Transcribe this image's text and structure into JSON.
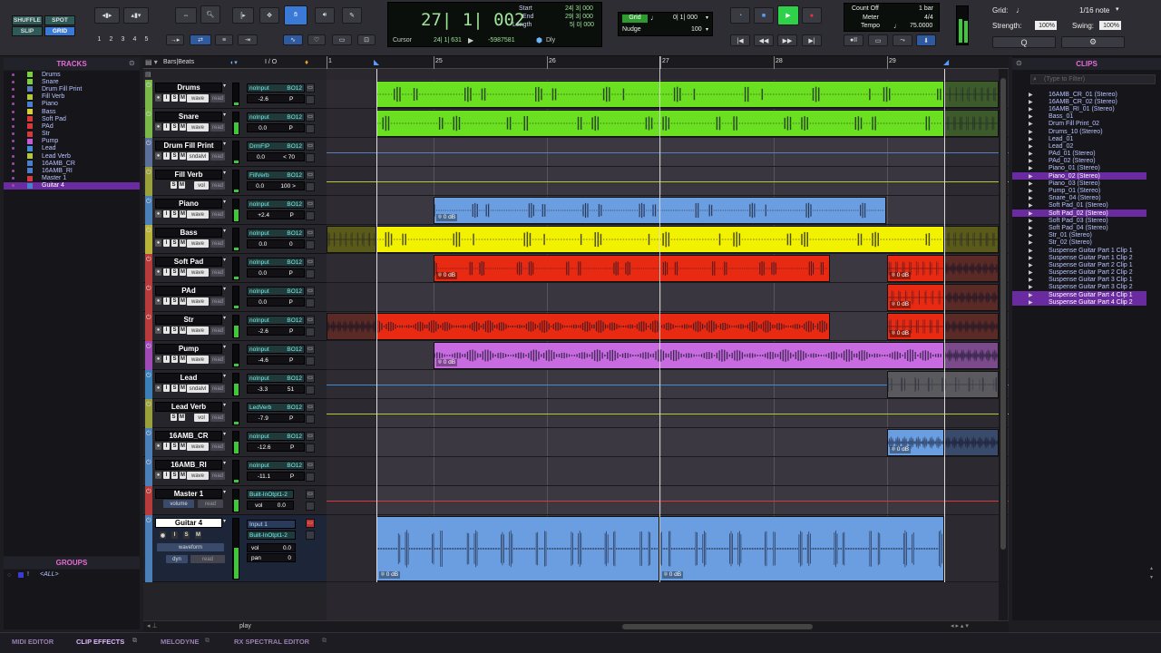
{
  "toolbar": {
    "modes": {
      "shuffle": "SHUFFLE",
      "spot": "SPOT",
      "slip": "SLIP",
      "grid": "GRID"
    },
    "zoom_presets": [
      "1",
      "2",
      "3",
      "4",
      "5"
    ],
    "main_counter": "27| 1| 002",
    "start_label": "Start",
    "end_label": "End",
    "length_label": "Length",
    "start_value": "24| 3| 000",
    "end_value": "29| 3| 000",
    "length_value": "5| 0| 000",
    "cursor_label": "Cursor",
    "cursor_value": "24| 1| 631",
    "sample_value": "-5987581",
    "dly_label": "Dly",
    "grid_label": "Grid",
    "grid_value": "0| 1| 000",
    "nudge_label": "Nudge",
    "nudge_value": "100",
    "count_off": "Count Off",
    "count_off_value": "1 bar",
    "meter_label": "Meter",
    "meter_value": "4/4",
    "tempo_label": "Tempo",
    "tempo_value": "75.0000",
    "midi_grid_label": "Grid:",
    "midi_grid_value": "1/16 note",
    "strength_label": "Strength:",
    "strength_value": "100%",
    "swing_label": "Swing:",
    "swing_value": "100%"
  },
  "tracks_panel": {
    "title": "TRACKS",
    "items": [
      {
        "name": "Drums",
        "color": "#7bd13a"
      },
      {
        "name": "Snare",
        "color": "#7bd13a"
      },
      {
        "name": "Drum Fill Print",
        "color": "#5a7dbd"
      },
      {
        "name": "Fill Verb",
        "color": "#b3c93a"
      },
      {
        "name": "Piano",
        "color": "#4a7fd0"
      },
      {
        "name": "Bass",
        "color": "#d6d13a"
      },
      {
        "name": "Soft Pad",
        "color": "#d63a3a"
      },
      {
        "name": "PAd",
        "color": "#d63a3a"
      },
      {
        "name": "Str",
        "color": "#d63a3a"
      },
      {
        "name": "Pump",
        "color": "#c45ad6"
      },
      {
        "name": "Lead",
        "color": "#3a8fd6"
      },
      {
        "name": "Lead Verb",
        "color": "#b3c93a"
      },
      {
        "name": "16AMB_CR",
        "color": "#4a7fd0"
      },
      {
        "name": "16AMB_RI",
        "color": "#4a7fd0"
      },
      {
        "name": "Master 1",
        "color": "#d63a3a"
      },
      {
        "name": "Guitar 4",
        "color": "#4a7fd0"
      }
    ]
  },
  "groups_panel": {
    "title": "GROUPS",
    "item": "<ALL>",
    "item_marker": "!"
  },
  "edit_header": {
    "ruler_label": "Bars|Beats",
    "io_label": "I / O"
  },
  "ruler_bars": [
    "1",
    "25",
    "26",
    "27",
    "28",
    "29"
  ],
  "track_headers": [
    {
      "name": "Drums",
      "input": "noInput",
      "output": "BO12",
      "vol": "-2.6",
      "pan": "P",
      "view": "wave",
      "auto": "read"
    },
    {
      "name": "Snare",
      "input": "noInput",
      "output": "BO12",
      "vol": "0.0",
      "pan": "P",
      "view": "wave",
      "auto": "read"
    },
    {
      "name": "Drum Fill Print",
      "input": "DrmFIP",
      "output": "BO12",
      "vol": "0.0",
      "pan": "< 70",
      "view": "sndalvl",
      "auto": "read"
    },
    {
      "name": "Fill Verb",
      "input": "FillVerb",
      "output": "BO12",
      "vol": "0.0",
      "pan": "100 >",
      "view": "vol",
      "auto": "read"
    },
    {
      "name": "Piano",
      "input": "noInput",
      "output": "BO12",
      "vol": "+2.4",
      "pan": "P",
      "view": "wave",
      "auto": "read"
    },
    {
      "name": "Bass",
      "input": "noInput",
      "output": "BO12",
      "vol": "0.0",
      "pan": "0",
      "view": "wave",
      "auto": "read"
    },
    {
      "name": "Soft Pad",
      "input": "noInput",
      "output": "BO12",
      "vol": "0.0",
      "pan": "P",
      "view": "wave",
      "auto": "read"
    },
    {
      "name": "PAd",
      "input": "noInput",
      "output": "BO12",
      "vol": "0.0",
      "pan": "P",
      "view": "wave",
      "auto": "read"
    },
    {
      "name": "Str",
      "input": "noInput",
      "output": "BO12",
      "vol": "-2.6",
      "pan": "P",
      "view": "wave",
      "auto": "read"
    },
    {
      "name": "Pump",
      "input": "noInput",
      "output": "BO12",
      "vol": "-4.6",
      "pan": "P",
      "view": "wave",
      "auto": "read"
    },
    {
      "name": "Lead",
      "input": "noInput",
      "output": "BO12",
      "vol": "-3.3",
      "pan": "51",
      "view": "sndalvl",
      "auto": "read"
    },
    {
      "name": "Lead Verb",
      "input": "LedVerb",
      "output": "BO12",
      "vol": "-7.9",
      "pan": "P",
      "view": "vol",
      "auto": "read"
    },
    {
      "name": "16AMB_CR",
      "input": "noInput",
      "output": "BO12",
      "vol": "-12.6",
      "pan": "P",
      "view": "wave",
      "auto": "read"
    },
    {
      "name": "16AMB_RI",
      "input": "noInput",
      "output": "BO12",
      "vol": "-11.1",
      "pan": "P",
      "view": "wave",
      "auto": "read"
    },
    {
      "name": "Master 1",
      "input": "Built-InOtpt1-2",
      "output": "",
      "vol": "0.0",
      "pan": "",
      "view": "volume",
      "auto": "read"
    },
    {
      "name": "Guitar 4",
      "input": "Input 1",
      "output": "Built-InOtpt1-2",
      "vol": "0.0",
      "pan": "0",
      "view": "waveform",
      "auto": "read"
    }
  ],
  "clip_gain": "0 dB",
  "bottom_label": "play",
  "clips_panel": {
    "title": "CLIPS",
    "filter_placeholder": "(Type to Filter)",
    "items": [
      "16AMB_CR_01 (Stereo)",
      "16AMB_CR_02 (Stereo)",
      "16AMB_RI_01 (Stereo)",
      "Bass_01",
      "Drum Fill Print_02",
      "Drums_10 (Stereo)",
      "Lead_01",
      "Lead_02",
      "PAd_01 (Stereo)",
      "PAd_02 (Stereo)",
      "Piano_01 (Stereo)",
      "Piano_02 (Stereo)",
      "Piano_03 (Stereo)",
      "Pump_01 (Stereo)",
      "Snare_04 (Stereo)",
      "Soft Pad_01 (Stereo)",
      "Soft Pad_02 (Stereo)",
      "Soft Pad_03 (Stereo)",
      "Soft Pad_04 (Stereo)",
      "Str_01 (Stereo)",
      "Str_02 (Stereo)",
      "Suspense Guitar Part 1 Clip 1",
      "Suspense Guitar Part 1 Clip 2",
      "Suspense Guitar Part 2 Clip 1",
      "Suspense Guitar Part 2 Clip 2",
      "Suspense Guitar Part 3 Clip 1",
      "Suspense Guitar Part 3 Clip 2",
      "Suspense Guitar Part 4 Clip 1",
      "Suspense Guitar Part 4 Clip 2"
    ],
    "selected": [
      11,
      16,
      27,
      28
    ]
  },
  "bottom_tabs": [
    "MIDI EDITOR",
    "CLIP EFFECTS",
    "MELODYNE",
    "RX SPECTRAL EDITOR"
  ],
  "colors": {
    "accent": "#e86ad6",
    "selection": "#6a2aa0",
    "green": "#6be020",
    "yellow": "#f2f200",
    "red": "#e82a12",
    "purple": "#c86ae0",
    "blue": "#6a9ee0"
  }
}
